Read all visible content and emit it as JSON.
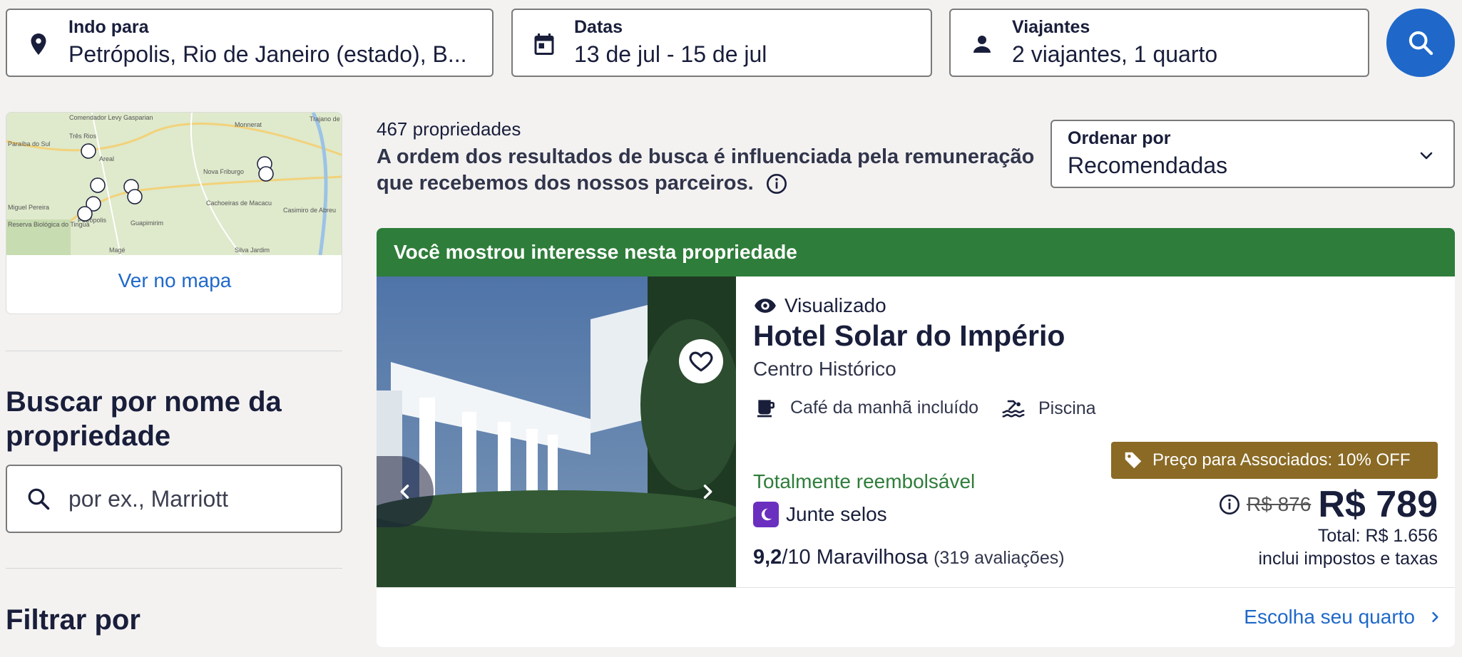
{
  "search": {
    "destination": {
      "label": "Indo para",
      "value": "Petrópolis, Rio de Janeiro (estado), B..."
    },
    "dates": {
      "label": "Datas",
      "value": "13 de jul - 15 de jul"
    },
    "travelers": {
      "label": "Viajantes",
      "value": "2 viajantes, 1 quarto"
    }
  },
  "sidebar": {
    "map_link": "Ver no mapa",
    "map_places": [
      "Comendador Levy Gasparian",
      "Três Rios",
      "Paraíba do Sul",
      "Areal",
      "Monnerat",
      "Trajano de Moraes",
      "Nova Friburgo",
      "Miguel Pereira",
      "Reserva Biológica do Tinguá",
      "Petrópolis",
      "Cachoeiras de Macacu",
      "Guapimirim",
      "Casimiro de Abreu",
      "Magé",
      "Silva Jardim"
    ],
    "name_search_title": "Buscar por nome da propriedade",
    "name_search_placeholder": "por ex., Marriott",
    "filter_title": "Filtrar por"
  },
  "results": {
    "count": "467 propriedades",
    "disclaimer": "A ordem dos resultados de busca é influenciada pela remuneração que recebemos dos nossos parceiros.",
    "sort": {
      "label": "Ordenar por",
      "value": "Recomendadas"
    }
  },
  "property": {
    "banner": "Você mostrou interesse nesta propriedade",
    "viewed": "Visualizado",
    "name": "Hotel Solar do Império",
    "neighborhood": "Centro Histórico",
    "amenities": [
      "Café da manhã incluído",
      "Piscina"
    ],
    "refund": "Totalmente reembolsável",
    "stamps": "Junte selos",
    "rating_score": "9,2",
    "rating_scale": "/10 Maravilhosa",
    "rating_reviews": "(319 avaliações)",
    "member_badge": "Preço para Associados: 10% OFF",
    "old_price": "R$ 876",
    "price": "R$ 789",
    "total": "Total: R$ 1.656",
    "taxes": "inclui impostos e taxas",
    "cta": "Escolha seu quarto"
  },
  "colors": {
    "accent": "#1f68c9",
    "banner": "#2e7d3a",
    "member": "#8a6a25",
    "stamp": "#6b2fbf"
  }
}
